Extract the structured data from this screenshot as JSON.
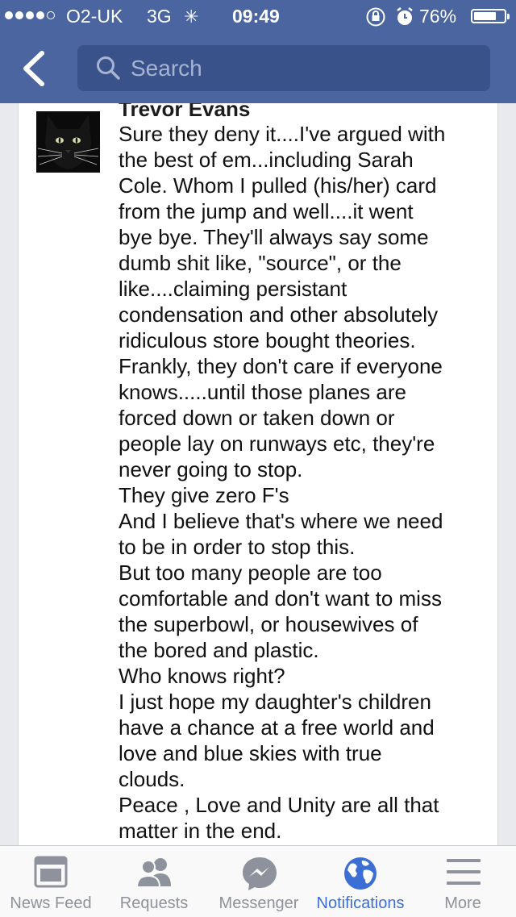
{
  "status_bar": {
    "carrier": "O2-UK",
    "network": "3G",
    "time": "09:49",
    "battery_percent": "76%",
    "battery_level": 0.76,
    "signal_bars_filled": 4,
    "signal_bars_total": 5,
    "activity_icon": "loading-spinner-icon",
    "icons": [
      "rotation-lock-icon",
      "alarm-clock-icon",
      "battery-icon"
    ]
  },
  "nav": {
    "back_icon": "chevron-left-icon",
    "search_placeholder": "Search",
    "background_color": "#4a65a0"
  },
  "comment": {
    "author": "Trevor Evans",
    "avatar_icon": "black-cat-avatar",
    "lines": [
      "Sure they deny it....I've argued with",
      "the best of em...including Sarah",
      "Cole. Whom I pulled (his/her) card",
      "from the jump and well....it went",
      "bye bye. They'll always say some",
      "dumb shit like, \"source\", or the",
      "like....claiming persistant",
      "condensation and other absolutely",
      "ridiculous store bought theories.",
      "Frankly, they don't care if everyone",
      "knows.....until those planes are",
      "forced down or taken down or",
      "people lay on runways etc, they're",
      "never going to stop.",
      "They give zero F's",
      "And I believe that's where we need",
      "to be in order to stop this.",
      "But too many people are too",
      "comfortable and don't want to miss",
      "the superbowl, or housewives of",
      "the bored and plastic.",
      "Who knows right?",
      "I just hope my daughter's children",
      "have a chance at a free world and",
      "love and blue skies with true",
      "clouds.",
      "Peace , Love and Unity are all that",
      "matter in the end."
    ]
  },
  "tab_bar": {
    "active_color": "#3b6fd6",
    "inactive_color": "#8d929c",
    "tabs": [
      {
        "label": "News Feed",
        "icon": "news-feed-icon"
      },
      {
        "label": "Requests",
        "icon": "friend-requests-icon"
      },
      {
        "label": "Messenger",
        "icon": "messenger-icon"
      },
      {
        "label": "Notifications",
        "icon": "globe-icon",
        "active": true
      },
      {
        "label": "More",
        "icon": "menu-icon"
      }
    ]
  }
}
